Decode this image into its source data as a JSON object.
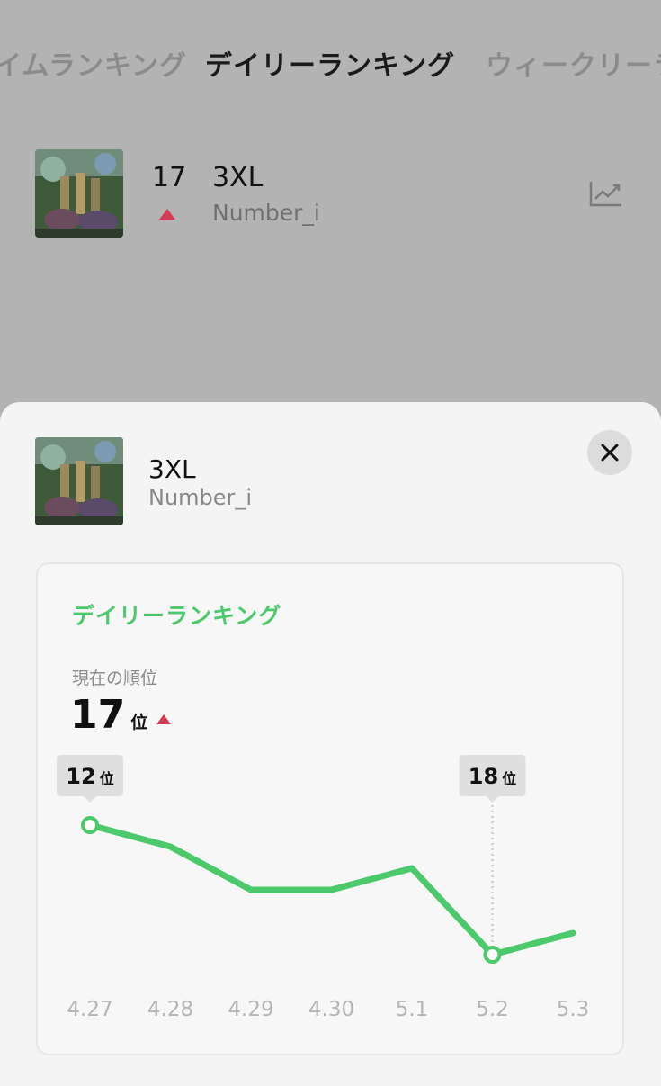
{
  "tabs": [
    {
      "label": "イムランキング"
    },
    {
      "label": "デイリーランキング"
    },
    {
      "label": "ウィークリーラ"
    }
  ],
  "list_row": {
    "rank": "17",
    "title": "3XL",
    "artist": "Number_i",
    "trend_icon": "up-triangle"
  },
  "sheet": {
    "title": "3XL",
    "artist": "Number_i",
    "close_icon": "close-icon"
  },
  "card": {
    "heading": "デイリーランキング",
    "subtitle": "現在の順位",
    "current_rank": "17",
    "rank_unit": "位"
  },
  "colors": {
    "accent_green": "#4cc96a",
    "up_red": "#d23c55"
  },
  "chart_data": {
    "type": "line",
    "categories": [
      "4.27",
      "4.28",
      "4.29",
      "4.30",
      "5.1",
      "5.2",
      "5.3"
    ],
    "series": [
      {
        "values": [
          12,
          13,
          15,
          15,
          14,
          18,
          17
        ]
      }
    ],
    "y_inverted": true,
    "ylim": [
      12,
      18
    ],
    "annotations": [
      {
        "category": "4.27",
        "value": "12",
        "unit": "位"
      },
      {
        "category": "5.2",
        "value": "18",
        "unit": "位"
      }
    ],
    "highlight_category": "5.2",
    "legend": "none",
    "grid": false
  }
}
